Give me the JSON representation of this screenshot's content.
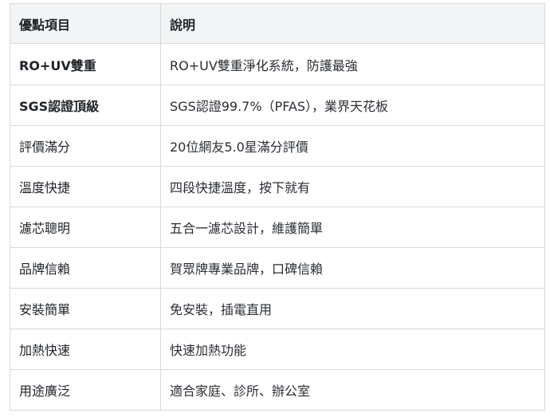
{
  "table": {
    "headers": [
      "優點項目",
      "說明"
    ],
    "rows": [
      {
        "item": "RO+UV雙重",
        "desc": "RO+UV雙重淨化系統，防護最強",
        "bold": true
      },
      {
        "item": "SGS認證頂級",
        "desc": "SGS認證99.7%（PFAS），業界天花板",
        "bold": true
      },
      {
        "item": "評價滿分",
        "desc": "20位網友5.0星滿分評價",
        "bold": false
      },
      {
        "item": "溫度快捷",
        "desc": "四段快捷溫度，按下就有",
        "bold": false
      },
      {
        "item": "濾芯聰明",
        "desc": "五合一濾芯設計，維護簡單",
        "bold": false
      },
      {
        "item": "品牌信賴",
        "desc": "賀眾牌專業品牌，口碑信賴",
        "bold": false
      },
      {
        "item": "安裝簡單",
        "desc": "免安裝，插電直用",
        "bold": false
      },
      {
        "item": "加熱快速",
        "desc": "快速加熱功能",
        "bold": false
      },
      {
        "item": "用途廣泛",
        "desc": "適合家庭、診所、辦公室",
        "bold": false
      }
    ]
  }
}
